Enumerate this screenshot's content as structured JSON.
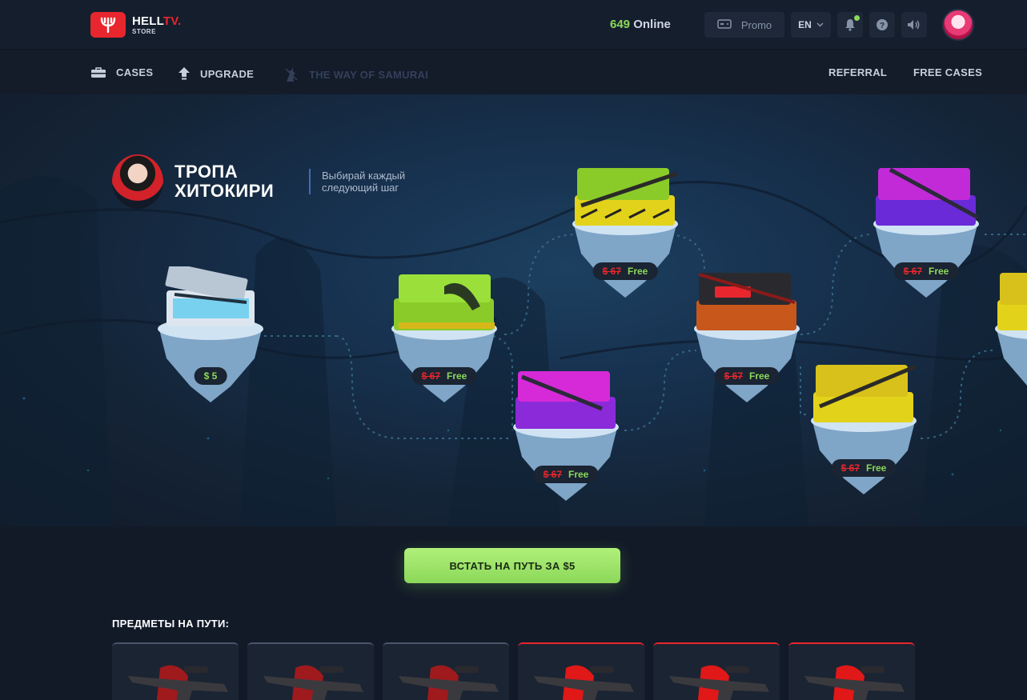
{
  "header": {
    "logo": {
      "name": "HELL",
      "name_accent": "TV.",
      "sub": "STORE"
    },
    "online": {
      "count": "649",
      "label": "Online"
    },
    "promo_label": "Promo",
    "language": "EN",
    "icons": [
      "promo-icon",
      "chevron-down-icon",
      "bell-icon",
      "help-icon",
      "sound-icon"
    ]
  },
  "nav": {
    "cases": "CASES",
    "upgrade": "UPGRADE",
    "samurai": "THE WAY OF SAMURAI",
    "referral": "REFERRAL",
    "free_cases": "FREE CASES"
  },
  "path": {
    "title": "ТРОПА ХИТОКИРИ",
    "description": "Выбирай каждый следующий шаг",
    "nodes": [
      {
        "id": "start",
        "price": "$ 5",
        "theme": "ice",
        "accent": "#dde6ef"
      },
      {
        "id": "n2",
        "old_price": "$ 67",
        "free": "Free",
        "accent": "#9be03a"
      },
      {
        "id": "n3",
        "old_price": "$ 67",
        "free": "Free",
        "accent": "#d62ad8"
      },
      {
        "id": "n4",
        "old_price": "$ 67",
        "free": "Free",
        "accent": "#e3d21a"
      },
      {
        "id": "n5",
        "old_price": "$ 67",
        "free": "Free",
        "accent": "#c8571c"
      },
      {
        "id": "n6",
        "old_price": "$ 67",
        "free": "Free",
        "accent": "#e3d21a"
      },
      {
        "id": "n7",
        "old_price": "$ 67",
        "free": "Free",
        "accent": "#b23ad8"
      },
      {
        "id": "n8",
        "accent": "#e3d21a"
      }
    ]
  },
  "cta_label": "ВСТАТЬ НА ПУТЬ ЗА $5",
  "items": {
    "title": "ПРЕДМЕТЫ НА ПУТИ:",
    "cards": [
      {
        "rarity": "grey"
      },
      {
        "rarity": "grey"
      },
      {
        "rarity": "grey"
      },
      {
        "rarity": "red"
      },
      {
        "rarity": "red"
      },
      {
        "rarity": "red"
      }
    ]
  },
  "colors": {
    "accent_green": "#8bd85a",
    "accent_red": "#e8262d",
    "background": "#121a28"
  }
}
